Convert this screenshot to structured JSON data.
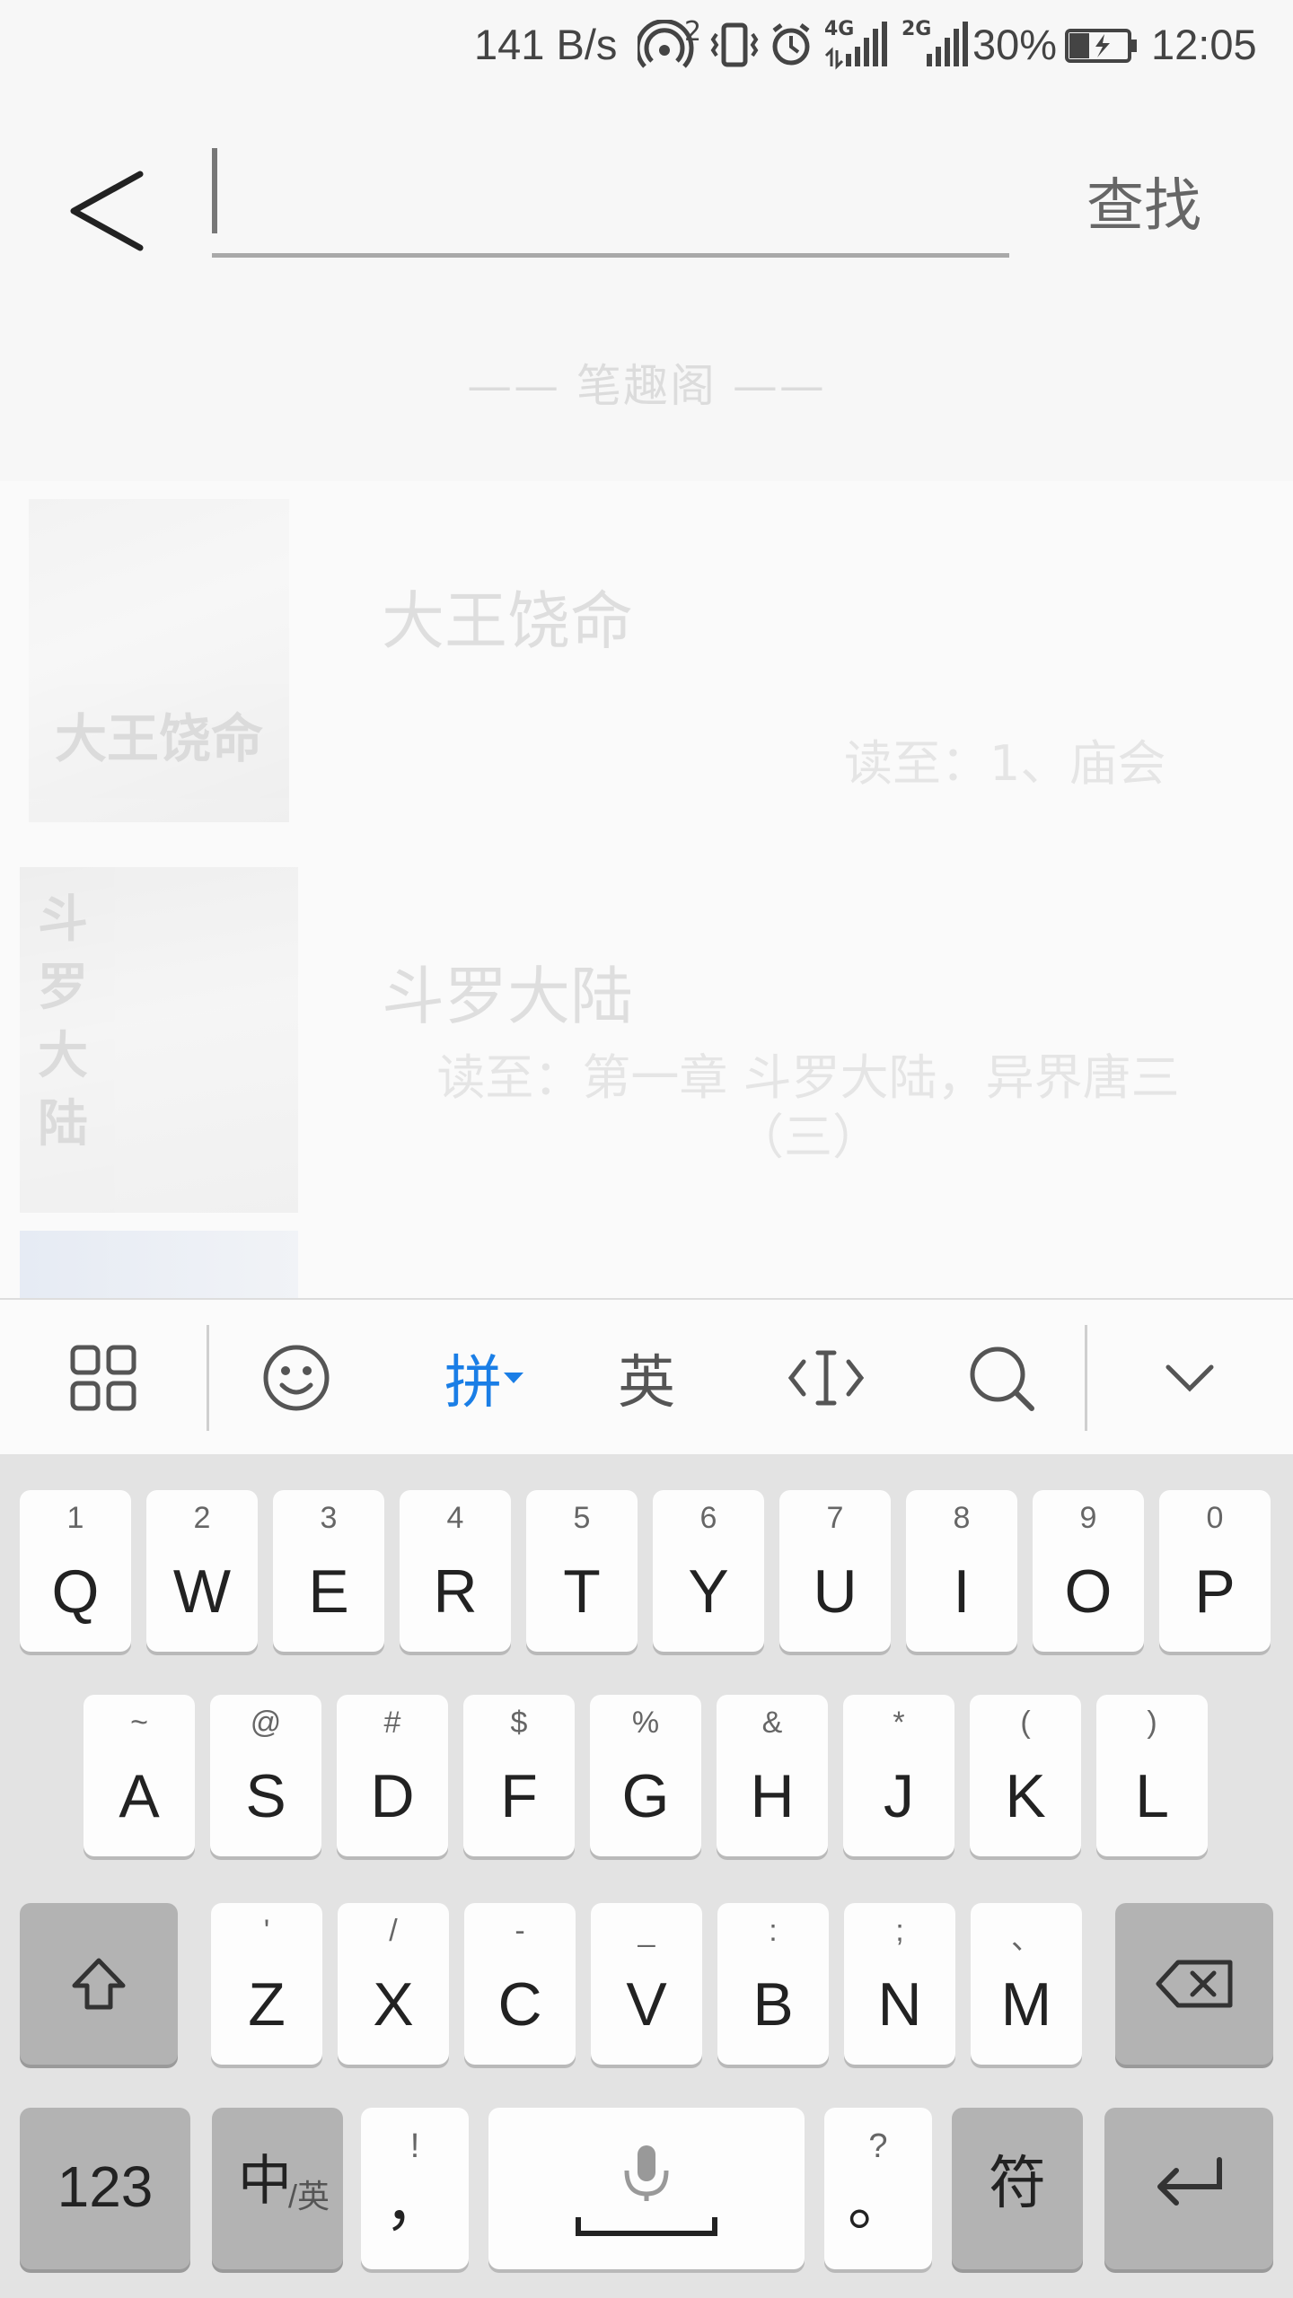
{
  "status_bar": {
    "net_speed": "141 B/s",
    "hotspot_badge": "2",
    "sim1_label": "4G",
    "sim2_label": "2G",
    "battery": "30%",
    "time": "12:05"
  },
  "search": {
    "value": "",
    "placeholder": "",
    "button_label": "查找"
  },
  "source_label": "—— 笔趣阁 ——",
  "books": [
    {
      "title": "大王饶命",
      "progress": "读至：1、庙会",
      "cover_text": "大王饶命"
    },
    {
      "title": "斗罗大陆",
      "progress": "读至：第一章 斗罗大陆，异界唐三（三）",
      "cover_text": "斗罗大陆"
    }
  ],
  "keyboard": {
    "toolbar": {
      "pinyin_label": "拼",
      "english_label": "英",
      "accent": "#1a7ee6"
    },
    "row1": [
      {
        "main": "Q",
        "sub": "1"
      },
      {
        "main": "W",
        "sub": "2"
      },
      {
        "main": "E",
        "sub": "3"
      },
      {
        "main": "R",
        "sub": "4"
      },
      {
        "main": "T",
        "sub": "5"
      },
      {
        "main": "Y",
        "sub": "6"
      },
      {
        "main": "U",
        "sub": "7"
      },
      {
        "main": "I",
        "sub": "8"
      },
      {
        "main": "O",
        "sub": "9"
      },
      {
        "main": "P",
        "sub": "0"
      }
    ],
    "row2": [
      {
        "main": "A",
        "sub": "~"
      },
      {
        "main": "S",
        "sub": "@"
      },
      {
        "main": "D",
        "sub": "#"
      },
      {
        "main": "F",
        "sub": "$"
      },
      {
        "main": "G",
        "sub": "%"
      },
      {
        "main": "H",
        "sub": "&"
      },
      {
        "main": "J",
        "sub": "*"
      },
      {
        "main": "K",
        "sub": "("
      },
      {
        "main": "L",
        "sub": ")"
      }
    ],
    "row3": [
      {
        "main": "Z",
        "sub": "'"
      },
      {
        "main": "X",
        "sub": "/"
      },
      {
        "main": "C",
        "sub": "-"
      },
      {
        "main": "V",
        "sub": "_"
      },
      {
        "main": "B",
        "sub": ":"
      },
      {
        "main": "N",
        "sub": ";"
      },
      {
        "main": "M",
        "sub": "、"
      }
    ],
    "num_key": "123",
    "zh_key": "中",
    "zh_key_sub": "/英",
    "comma_key": "，",
    "comma_sub": "!",
    "period_key": "。",
    "period_sub": "?",
    "symbol_key": "符"
  }
}
